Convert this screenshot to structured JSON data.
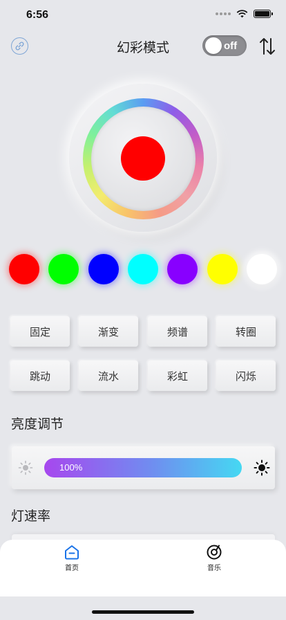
{
  "status_bar": {
    "time": "6:56"
  },
  "header": {
    "title": "幻彩模式",
    "power_toggle": {
      "label": "off",
      "on": false
    }
  },
  "color_wheel": {
    "selected_color": "#ff0000"
  },
  "swatches": [
    "#ff0000",
    "#00ff00",
    "#0000ff",
    "#00ffff",
    "#8800ff",
    "#ffff00",
    "#ffffff"
  ],
  "modes": [
    "固定",
    "渐变",
    "频谱",
    "转圈",
    "跳动",
    "流水",
    "彩虹",
    "闪烁"
  ],
  "brightness": {
    "title": "亮度调节",
    "value_label": "100%",
    "value": 1.0
  },
  "speed": {
    "title": "灯速率"
  },
  "tab_bar": {
    "home_label": "首页",
    "music_label": "音乐",
    "accent": "#1a73e8"
  }
}
